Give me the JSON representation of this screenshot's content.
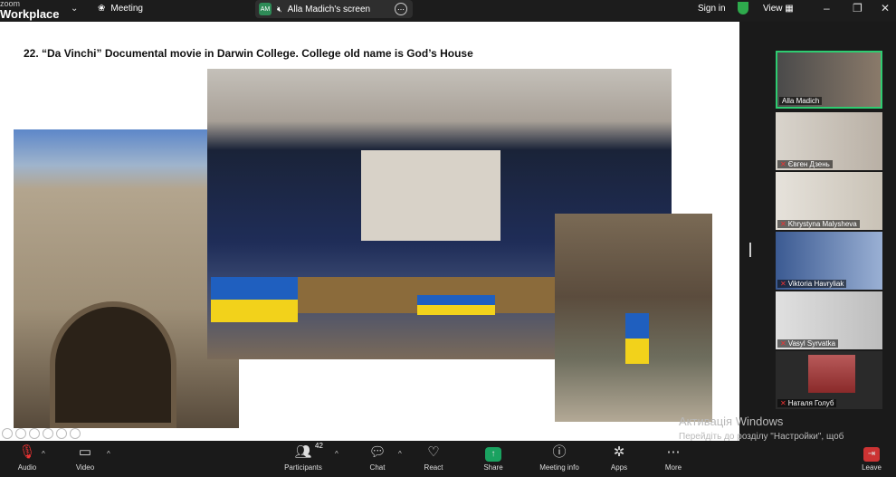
{
  "app": {
    "brand_small": "zoom",
    "brand_big": "Workplace"
  },
  "topbar": {
    "meeting_label": "Meeting",
    "share_avatar_initials": "AM",
    "share_label": "Alla Madich's screen",
    "signin_label": "Sign in",
    "view_label": "View"
  },
  "slide": {
    "title": "22. “Da Vinchi” Documental movie in Darwin College. College old name is God’s House"
  },
  "participants": [
    {
      "name": "Alla Madich",
      "muted": false,
      "active": true
    },
    {
      "name": "Євген Дзень",
      "muted": true,
      "active": false
    },
    {
      "name": "Khrystyna Malysheva",
      "muted": true,
      "active": false
    },
    {
      "name": "Viktoria Havryliak",
      "muted": true,
      "active": false
    },
    {
      "name": "Vasyl Syrvatka",
      "muted": true,
      "active": false
    },
    {
      "name": "Наталя Голуб",
      "muted": true,
      "active": false
    }
  ],
  "watermark": {
    "line1": "Активація Windows",
    "line2": "Перейдіть до розділу \"Настройки\", щоб активувати Windows."
  },
  "toolbar": {
    "audio": "Audio",
    "video": "Video",
    "participants": "Participants",
    "participants_count": "42",
    "chat": "Chat",
    "react": "React",
    "share": "Share",
    "meeting_info": "Meeting info",
    "apps": "Apps",
    "more": "More",
    "leave": "Leave"
  },
  "colors": {
    "active_border": "#2ecc71",
    "share_green": "#1aa260",
    "leave_red": "#cc3333"
  }
}
